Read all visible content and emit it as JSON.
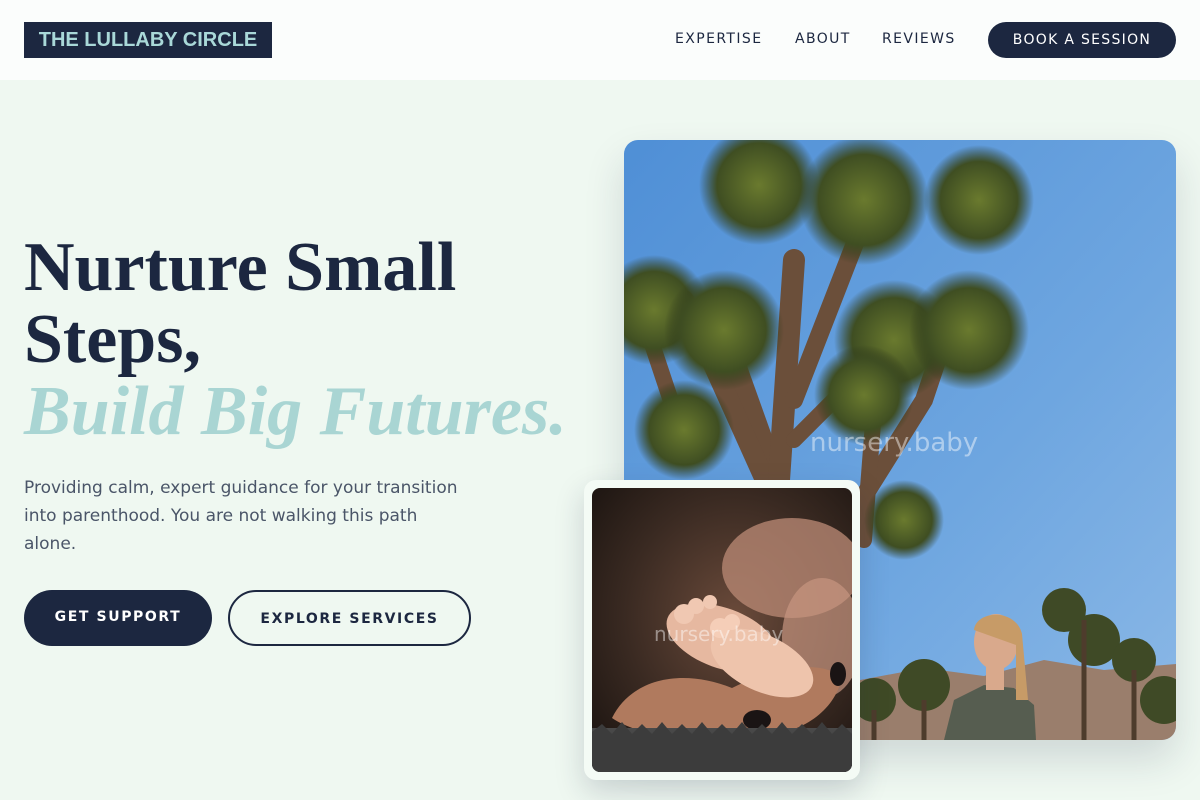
{
  "brand": {
    "name": "THE LULLABY CIRCLE"
  },
  "nav": {
    "links": [
      "EXPERTISE",
      "ABOUT",
      "REVIEWS"
    ],
    "cta": "BOOK A SESSION"
  },
  "hero": {
    "headline_line1": "Nurture Small",
    "headline_line2": "Steps,",
    "headline_accent": "Build Big Futures.",
    "intro": "Providing calm, expert guidance for your transition into parenthood. You are not walking this path alone.",
    "primary_button": "GET SUPPORT",
    "secondary_button": "EXPLORE SERVICES"
  },
  "images": {
    "desert_watermark": "nursery.baby",
    "feet_watermark": "nursery.baby"
  },
  "colors": {
    "navy": "#1c2740",
    "mint_background": "#eff8f1",
    "accent_teal": "#a9d5d3"
  }
}
